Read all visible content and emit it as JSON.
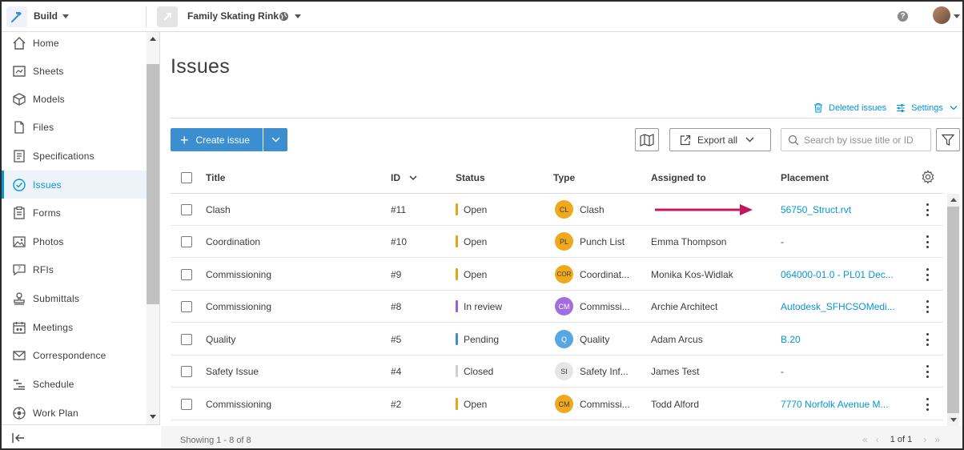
{
  "topbar": {
    "app_name": "Build",
    "project_name": "Family Skating Rink",
    "help_label": "?"
  },
  "sidebar": {
    "items": [
      {
        "label": "Home",
        "icon": "home-icon"
      },
      {
        "label": "Sheets",
        "icon": "sheets-icon"
      },
      {
        "label": "Models",
        "icon": "cube-icon"
      },
      {
        "label": "Files",
        "icon": "file-icon"
      },
      {
        "label": "Specifications",
        "icon": "specifications-icon"
      },
      {
        "label": "Issues",
        "icon": "check-circle-icon",
        "active": true
      },
      {
        "label": "Forms",
        "icon": "clipboard-icon"
      },
      {
        "label": "Photos",
        "icon": "photo-icon"
      },
      {
        "label": "RFIs",
        "icon": "chat-question-icon"
      },
      {
        "label": "Submittals",
        "icon": "stamp-icon"
      },
      {
        "label": "Meetings",
        "icon": "calendar-icon"
      },
      {
        "label": "Correspondence",
        "icon": "mail-icon"
      },
      {
        "label": "Schedule",
        "icon": "schedule-icon"
      },
      {
        "label": "Work Plan",
        "icon": "work-plan-icon"
      }
    ]
  },
  "main": {
    "title": "Issues",
    "deleted_issues": "Deleted issues",
    "settings": "Settings",
    "create_issue": "Create issue",
    "export_all": "Export all",
    "search_placeholder": "Search by issue title or ID",
    "accent_color": "#3b8fd1",
    "link_color": "#0696d7"
  },
  "table": {
    "headers": {
      "title": "Title",
      "id": "ID",
      "status": "Status",
      "type": "Type",
      "assigned": "Assigned to",
      "placement": "Placement"
    },
    "rows": [
      {
        "title": "Clash",
        "id": "#11",
        "status": "Open",
        "status_color": "#e8a317",
        "badge": "CL",
        "badge_color": "#f0a81c",
        "type": "Clash",
        "assigned": "",
        "placement": "56750_Struct.rvt",
        "placement_link": true
      },
      {
        "title": "Coordination",
        "id": "#10",
        "status": "Open",
        "status_color": "#e8a317",
        "badge": "PL",
        "badge_color": "#f0a81c",
        "type": "Punch List",
        "assigned": "Emma Thompson",
        "placement": "-",
        "placement_link": false
      },
      {
        "title": "Commissioning",
        "id": "#9",
        "status": "Open",
        "status_color": "#e8a317",
        "badge": "COR",
        "badge_color": "#f0a81c",
        "type": "Coordinat...",
        "assigned": "Monika Kos-Widlak",
        "placement": "064000-01.0 - PL01 Dec...",
        "placement_link": true
      },
      {
        "title": "Commissioning",
        "id": "#8",
        "status": "In review",
        "status_color": "#9b5de5",
        "badge": "CM",
        "badge_color": "#a06ee0",
        "type": "Commissi...",
        "assigned": "Archie Architect",
        "placement": "Autodesk_SFHCSOMedi...",
        "placement_link": true
      },
      {
        "title": "Quality",
        "id": "#5",
        "status": "Pending",
        "status_color": "#3b8fd1",
        "badge": "Q",
        "badge_color": "#5aa6e3",
        "type": "Quality",
        "assigned": "Adam Arcus",
        "placement": "B.20",
        "placement_link": true
      },
      {
        "title": "Safety Issue",
        "id": "#4",
        "status": "Closed",
        "status_color": "#cfcfcf",
        "badge": "SI",
        "badge_color": "#e6e6e6",
        "type": "Safety Inf...",
        "assigned": "James Test",
        "placement": "-",
        "placement_link": false
      },
      {
        "title": "Commissioning",
        "id": "#2",
        "status": "Open",
        "status_color": "#e8a317",
        "badge": "CM",
        "badge_color": "#f0a81c",
        "type": "Commissi...",
        "assigned": "Todd Alford",
        "placement": "7770 Norfolk Avenue M...",
        "placement_link": true
      }
    ]
  },
  "footer": {
    "showing": "Showing 1 - 8 of 8",
    "page": "1 of 1"
  }
}
